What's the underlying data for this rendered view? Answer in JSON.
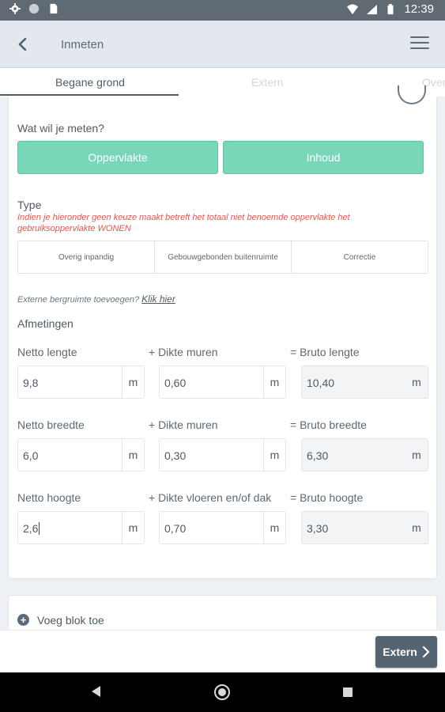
{
  "status_bar": {
    "time": "12:39"
  },
  "app_bar": {
    "title": "Inmeten"
  },
  "tabs": [
    {
      "label": "Begane grond",
      "active": true
    },
    {
      "label": "Extern",
      "active": false
    },
    {
      "label": "Over",
      "active": false
    }
  ],
  "measure": {
    "question": "Wat wil je meten?",
    "options": [
      "Oppervlakte",
      "Inhoud"
    ]
  },
  "type": {
    "label": "Type",
    "note": "Indien je hieronder geen keuze maakt betreft het totaal niet benoemde oppervlakte het gebruiksoppervlakte WONEN",
    "segments": [
      "Overig inpandig",
      "Gebouwgebonden buitenruimte",
      "Correctie"
    ]
  },
  "extra": {
    "text": "Externe bergruimte toevoegen?",
    "link": "Klik hier"
  },
  "afmetingen": {
    "heading": "Afmetingen",
    "rows": [
      {
        "net_label": "Netto lengte",
        "net_value": "9,8",
        "add_label": "+ Dikte muren",
        "add_value": "0,60",
        "gross_label": "= Bruto lengte",
        "gross_value": "10,40"
      },
      {
        "net_label": "Netto breedte",
        "net_value": "6,0",
        "add_label": "+ Dikte muren",
        "add_value": "0,30",
        "gross_label": "= Bruto breedte",
        "gross_value": "6,30"
      },
      {
        "net_label": "Netto hoogte",
        "net_value": "2,6",
        "add_label": "+ Dikte vloeren en/of dak",
        "add_value": "0,70",
        "gross_label": "= Bruto hoogte",
        "gross_value": "3,30"
      }
    ],
    "unit": "m"
  },
  "add_block": {
    "label": "Voeg blok toe"
  },
  "next_button": {
    "label": "Extern"
  },
  "colors": {
    "accent_green": "#79d6b8",
    "primary_dark": "#536472",
    "warning_red": "#e8544a"
  }
}
